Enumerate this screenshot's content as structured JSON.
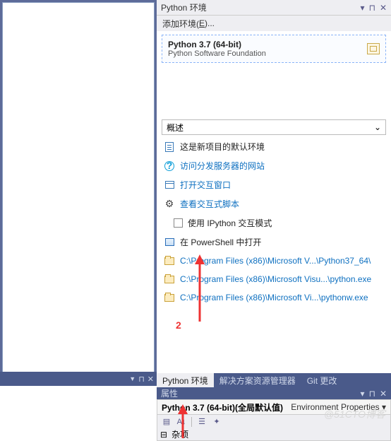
{
  "panel": {
    "title": "Python 环境",
    "add_env_prefix": "添加环境(",
    "add_env_key": "E",
    "add_env_suffix": ")...",
    "env": {
      "name": "Python 3.7 (64-bit)",
      "vendor": "Python Software Foundation"
    },
    "overview": "概述",
    "rows": {
      "default_env": "这是新项目的默认环境",
      "visit_site": "访问分发服务器的网站",
      "open_window": "打开交互窗口",
      "view_scripts": "查看交互式脚本",
      "use_ipython": "使用 IPython 交互模式",
      "open_ps_pre": "在 ",
      "open_ps_link": "PowerShell",
      "open_ps_post": " 中打开",
      "path1": "C:\\Program Files (x86)\\Microsoft V...\\Python37_64\\",
      "path2": "C:\\Program Files (x86)\\Microsoft Visu...\\python.exe",
      "path3": "C:\\Program Files (x86)\\Microsoft Vi...\\pythonw.exe"
    }
  },
  "tabs": {
    "env": "Python 环境",
    "sln": "解决方案资源管理器",
    "git": "Git 更改"
  },
  "props": {
    "title": "属性",
    "name": "Python 3.7 (64-bit)(全局默认值)",
    "category": "Environment Properties",
    "misc": "杂项"
  },
  "annotations": {
    "num2": "2"
  },
  "watermark": "@51CTO博客"
}
